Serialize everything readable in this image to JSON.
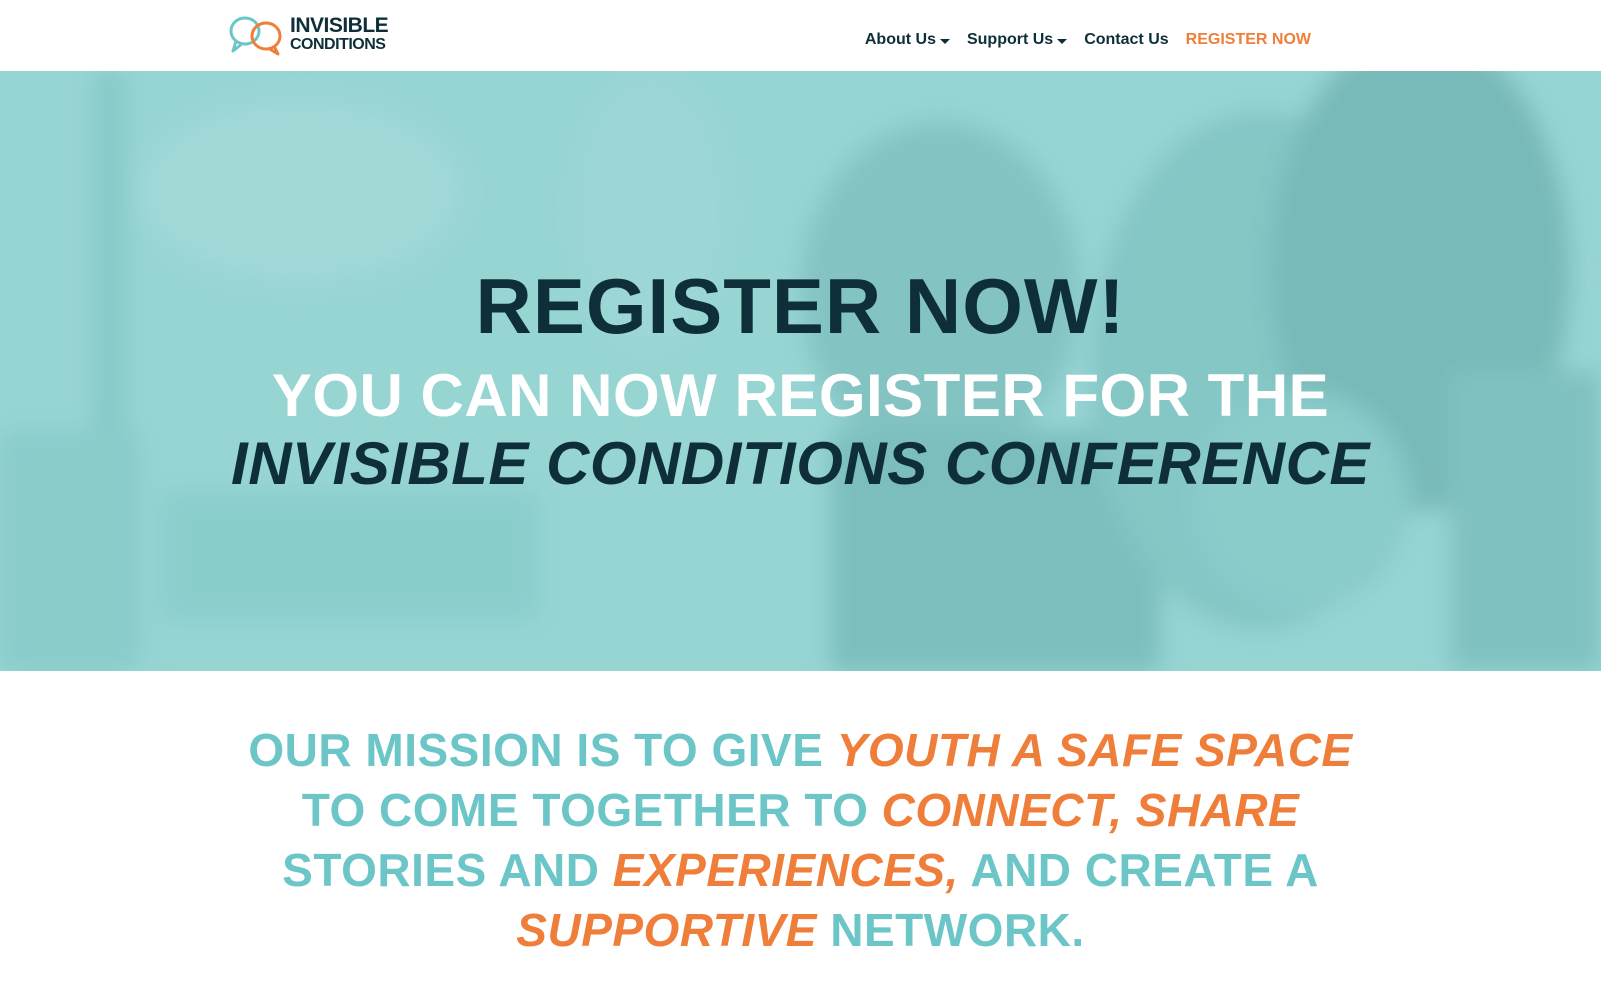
{
  "logo": {
    "name": "INVISIBLE CONDITIONS",
    "line1": "INVISIBLE",
    "line2": "CONDITIONS"
  },
  "nav": {
    "items": [
      {
        "label": "About Us",
        "dropdown": true
      },
      {
        "label": "Support Us",
        "dropdown": true
      },
      {
        "label": "Contact Us",
        "dropdown": false
      },
      {
        "label": "REGISTER NOW",
        "dropdown": false
      }
    ]
  },
  "hero": {
    "title": "REGISTER NOW!",
    "subtitle_line1": "YOU CAN NOW REGISTER FOR THE",
    "subtitle_line2": "INVISIBLE CONDITIONS CONFERENCE"
  },
  "mission": {
    "line1_plain": "OUR MISSION IS TO GIVE",
    "line1_highlight": "YOUTH A SAFE SPACE",
    "line2_plain": "TO COME TOGETHER TO",
    "line2_highlight": "CONNECT, SHARE",
    "line3_plain": "STORIES AND",
    "line3_highlight": "EXPERIENCES,",
    "line3_plain2": "AND CREATE A",
    "line4_highlight": "SUPPORTIVE",
    "line4_plain": "NETWORK."
  },
  "colors": {
    "navy": "#0e2f3a",
    "teal": "#6cc6c8",
    "orange": "#ef7e3a",
    "hero_overlay": "#93d3d2"
  }
}
